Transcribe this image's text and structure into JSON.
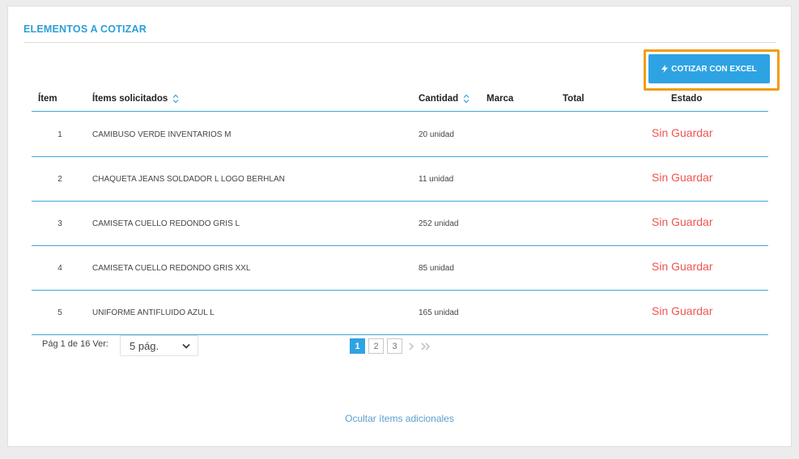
{
  "section": {
    "title": "ELEMENTOS A COTIZAR"
  },
  "toolbar": {
    "excel_label": "COTIZAR CON EXCEL",
    "icon": "bolt-icon",
    "accent": "#2ea3e3",
    "highlight": "#f39c12"
  },
  "table": {
    "headers": {
      "item": "Ítem",
      "solicitados": "Ítems solicitados",
      "cantidad": "Cantidad",
      "marca": "Marca",
      "total": "Total",
      "estado": "Estado"
    },
    "rows": [
      {
        "num": "1",
        "name": "CAMIBUSO VERDE INVENTARIOS M",
        "qty": "20 unidad",
        "state": "Sin Guardar"
      },
      {
        "num": "2",
        "name": "CHAQUETA JEANS SOLDADOR L LOGO BERHLAN",
        "qty": "11 unidad",
        "state": "Sin Guardar"
      },
      {
        "num": "3",
        "name": "CAMISETA CUELLO REDONDO GRIS L",
        "qty": "252 unidad",
        "state": "Sin Guardar"
      },
      {
        "num": "4",
        "name": "CAMISETA CUELLO REDONDO GRIS XXL",
        "qty": "85 unidad",
        "state": "Sin Guardar"
      },
      {
        "num": "5",
        "name": "UNIFORME ANTIFLUIDO AZUL L",
        "qty": "165 unidad",
        "state": "Sin Guardar"
      }
    ],
    "state_color": "#f0544f"
  },
  "pagination": {
    "info": "Pág 1 de 16 Ver:",
    "per_page": "5 pág.",
    "pages": [
      "1",
      "2",
      "3"
    ],
    "current": "1"
  },
  "footer": {
    "hide_label": "Ocultar ítems adicionales"
  }
}
